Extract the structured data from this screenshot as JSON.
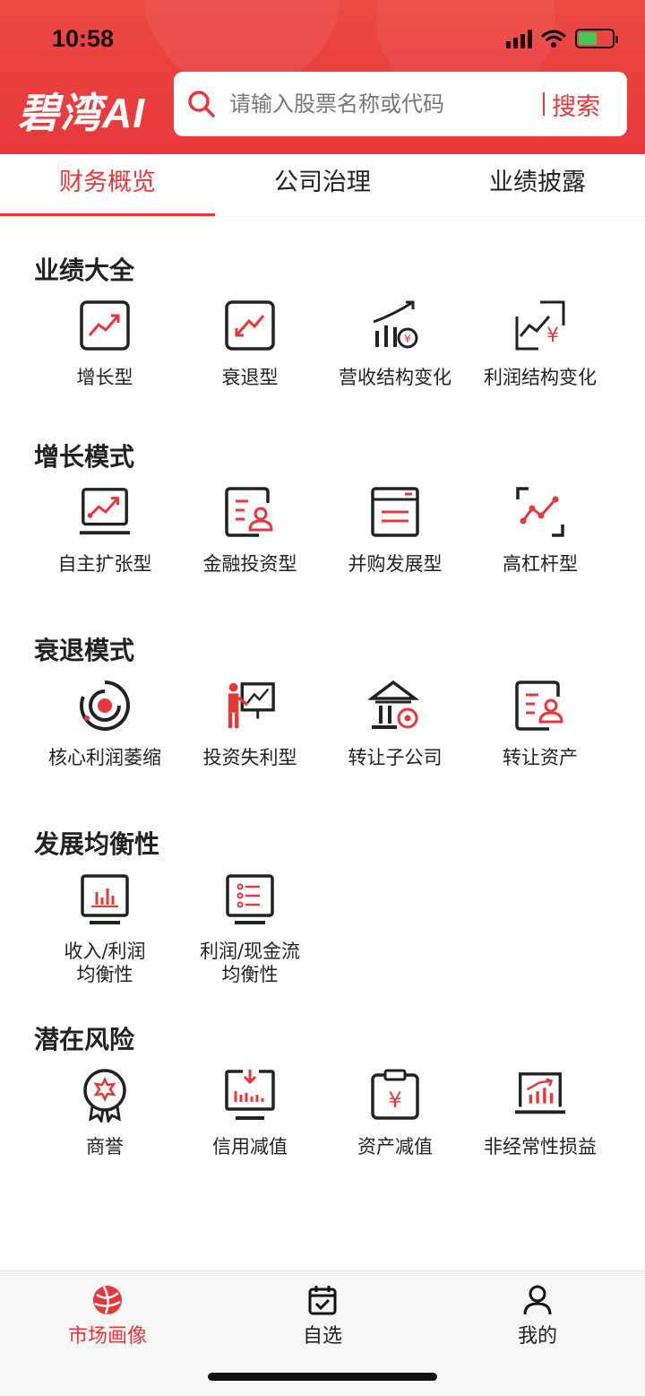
{
  "status_bar": {
    "time": "10:58"
  },
  "header": {
    "logo": "碧湾AI",
    "search": {
      "placeholder": "请输入股票名称或代码",
      "button": "搜索"
    }
  },
  "tabs": [
    {
      "label": "财务概览",
      "active": true
    },
    {
      "label": "公司治理",
      "active": false
    },
    {
      "label": "业绩披露",
      "active": false
    }
  ],
  "sections": [
    {
      "title": "业绩大全",
      "items": [
        {
          "label": "增长型",
          "icon": "growth-chart-icon"
        },
        {
          "label": "衰退型",
          "icon": "decline-chart-icon"
        },
        {
          "label": "营收结构变化",
          "icon": "revenue-structure-icon"
        },
        {
          "label": "利润结构变化",
          "icon": "profit-structure-icon"
        }
      ]
    },
    {
      "title": "增长模式",
      "items": [
        {
          "label": "自主扩张型",
          "icon": "laptop-growth-icon"
        },
        {
          "label": "金融投资型",
          "icon": "finance-invest-icon"
        },
        {
          "label": "并购发展型",
          "icon": "merger-icon"
        },
        {
          "label": "高杠杆型",
          "icon": "leverage-icon"
        }
      ]
    },
    {
      "title": "衰退模式",
      "items": [
        {
          "label": "核心利润萎缩",
          "icon": "target-icon"
        },
        {
          "label": "投资失利型",
          "icon": "presenter-icon"
        },
        {
          "label": "转让子公司",
          "icon": "bank-icon"
        },
        {
          "label": "转让资产",
          "icon": "asset-transfer-icon"
        }
      ]
    },
    {
      "title": "发展均衡性",
      "items": [
        {
          "label": "收入/利润\n均衡性",
          "line1": "收入/利润",
          "line2": "均衡性",
          "icon": "monitor-bar-icon"
        },
        {
          "label": "利润/现金流\n均衡性",
          "line1": "利润/现金流",
          "line2": "均衡性",
          "icon": "monitor-list-icon"
        }
      ]
    },
    {
      "title": "潜在风险",
      "items": [
        {
          "label": "商誉",
          "icon": "badge-icon"
        },
        {
          "label": "信用减值",
          "icon": "credit-impairment-icon"
        },
        {
          "label": "资产减值",
          "icon": "clipboard-yen-icon"
        },
        {
          "label": "非经常性损益",
          "icon": "laptop-bars-icon"
        }
      ]
    }
  ],
  "bottom_nav": [
    {
      "label": "市场画像",
      "icon": "globe-icon",
      "active": true
    },
    {
      "label": "自选",
      "icon": "calendar-check-icon",
      "active": false
    },
    {
      "label": "我的",
      "icon": "user-icon",
      "active": false
    }
  ],
  "colors": {
    "accent": "#e8373b",
    "text": "#222222",
    "header_bg": "#ec4a43"
  }
}
